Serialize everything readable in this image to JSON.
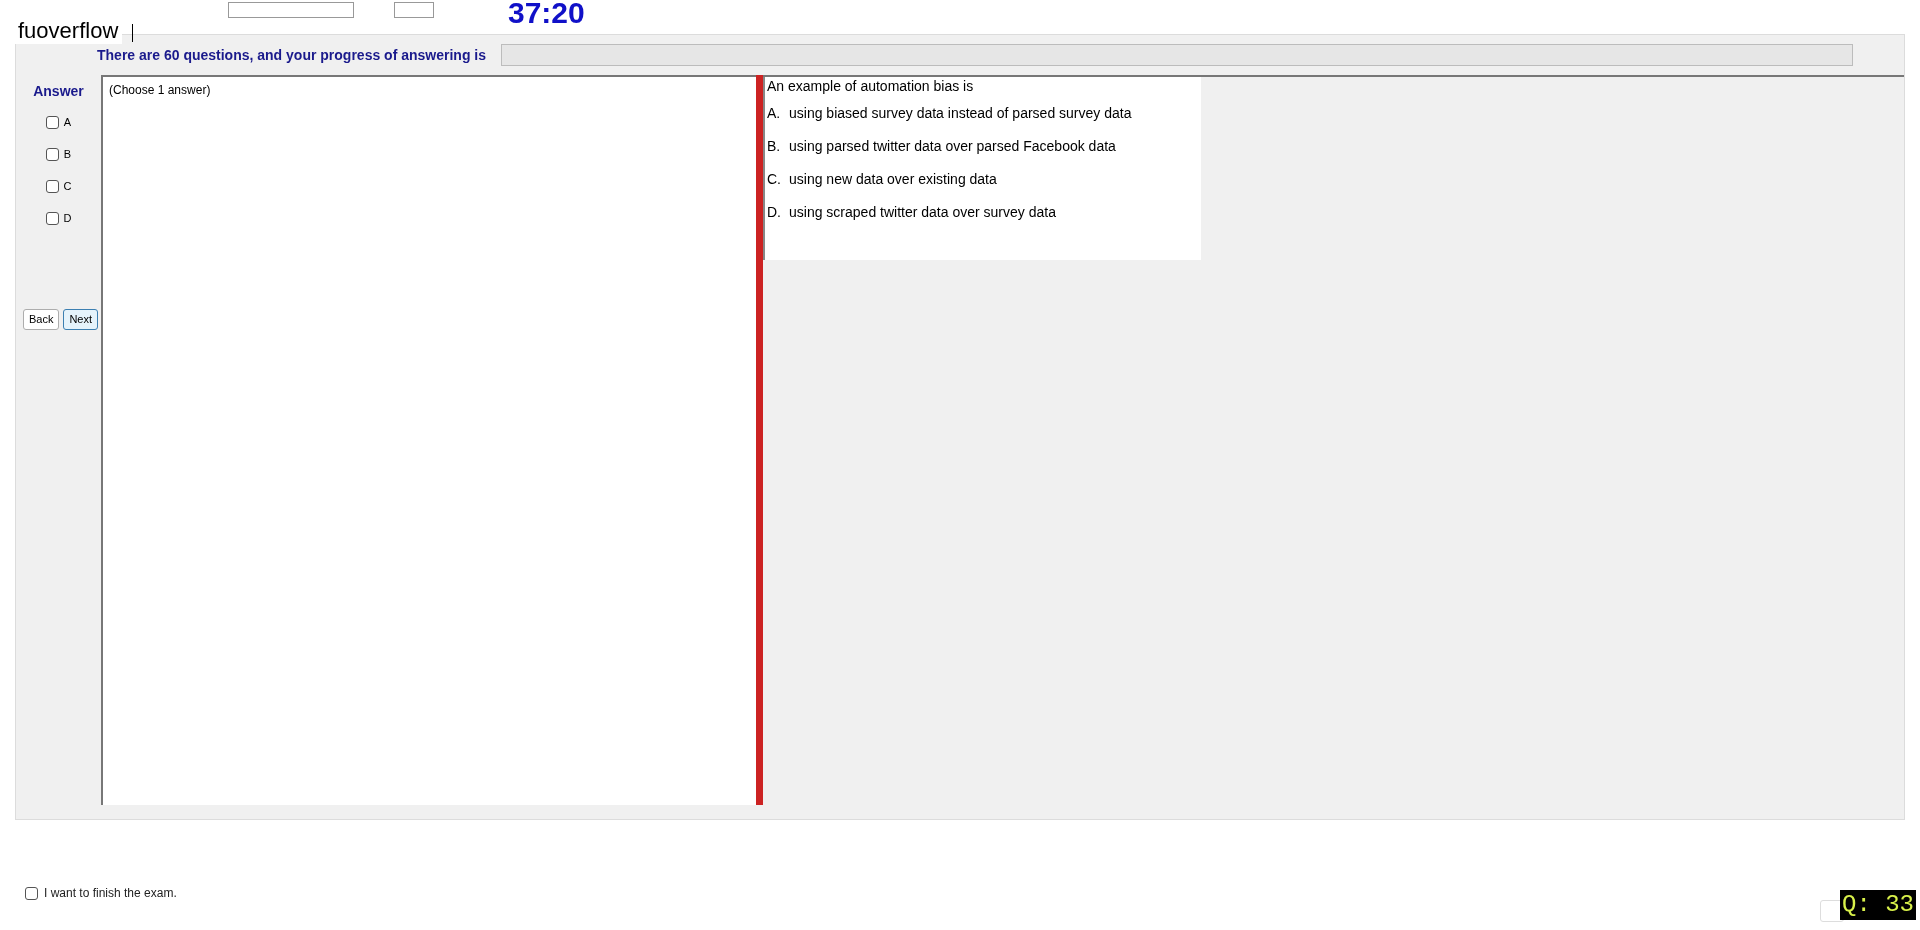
{
  "header": {
    "brand": "fuoverflow",
    "timer": "37:20"
  },
  "progress": {
    "label": "There are 60 questions, and your progress of answering is",
    "level": 0
  },
  "answer_panel": {
    "title": "Answer",
    "options": [
      {
        "label": "A",
        "checked": false
      },
      {
        "label": "B",
        "checked": false
      },
      {
        "label": "C",
        "checked": false
      },
      {
        "label": "D",
        "checked": false
      }
    ],
    "buttons": [
      {
        "label": "Back",
        "selected": false
      },
      {
        "label": "Next",
        "selected": true
      }
    ]
  },
  "instruction": "(Choose 1 answer)",
  "question": {
    "text": "An example of automation bias is",
    "choices": [
      {
        "letter": "A.",
        "text": "using biased survey data instead of parsed survey data"
      },
      {
        "letter": "B.",
        "text": "using parsed twitter data over parsed Facebook data"
      },
      {
        "letter": "C.",
        "text": "using new data over existing data"
      },
      {
        "letter": "D.",
        "text": "using scraped twitter data over survey data"
      }
    ]
  },
  "finish": {
    "label": "I want to finish the exam.",
    "checked": false
  },
  "question_number": "Q: 33"
}
